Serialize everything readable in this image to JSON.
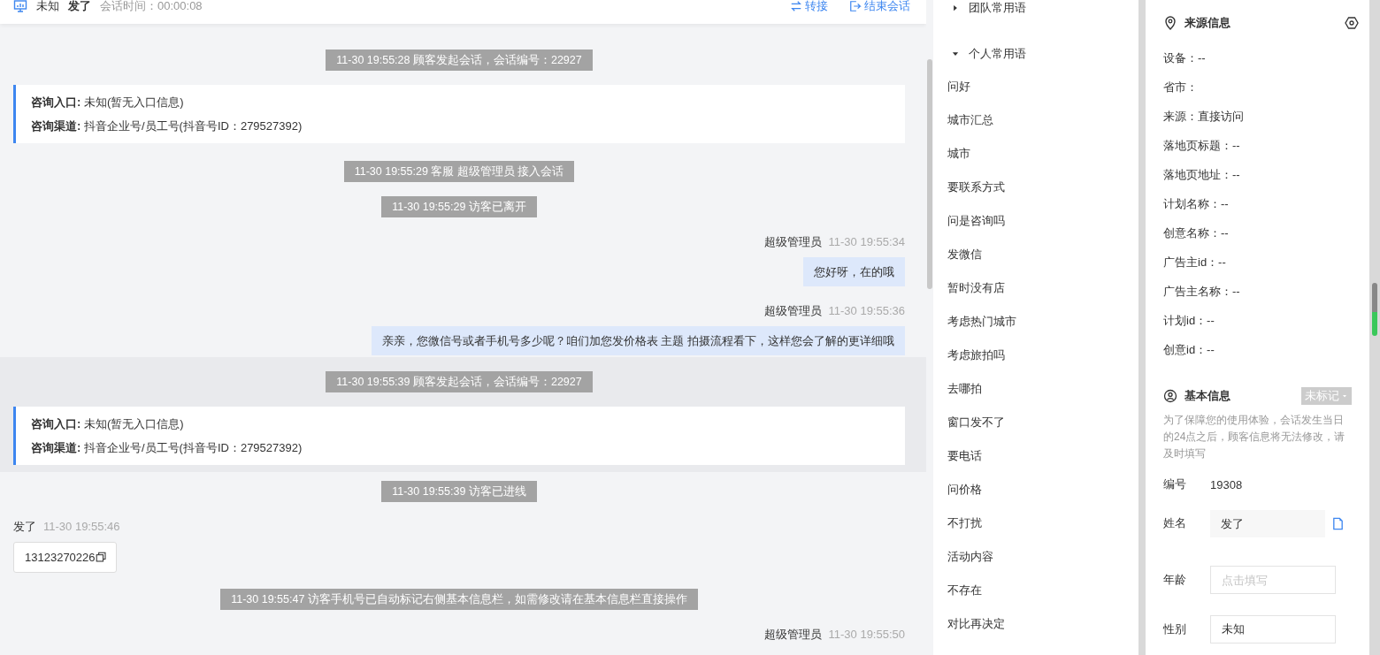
{
  "header": {
    "status": "未知",
    "name": "发了",
    "session_time": "会话时间：00:00:08",
    "actions": [
      {
        "kind": "transfer",
        "label": "转接"
      },
      {
        "kind": "end",
        "label": "结束会话"
      }
    ]
  },
  "chat": {
    "sessions": [
      {
        "highlighted": false,
        "messages": [
          {
            "kind": "system",
            "text": "11-30 19:55:28 顾客发起会话，会话编号：22927"
          },
          {
            "kind": "entry-card",
            "lines": [
              {
                "label": "咨询入口:",
                "value": "未知(暂无入口信息)"
              },
              {
                "label": "咨询渠道:",
                "value": "抖音企业号/员工号(抖音号ID：279527392)"
              }
            ]
          },
          {
            "kind": "system",
            "text": "11-30 19:55:29 客服 超级管理员 接入会话"
          },
          {
            "kind": "system",
            "text": "11-30 19:55:29 访客已离开"
          },
          {
            "kind": "agent",
            "sender": "超级管理员",
            "time": "11-30 19:55:34",
            "text": "您好呀，在的哦"
          },
          {
            "kind": "agent",
            "sender": "超级管理员",
            "time": "11-30 19:55:36",
            "text": "亲亲，您微信号或者手机号多少呢？咱们加您发价格表 主题 拍摄流程看下，这样您会了解的更详细哦"
          }
        ]
      },
      {
        "highlighted": true,
        "messages": [
          {
            "kind": "system",
            "text": "11-30 19:55:39 顾客发起会话，会话编号：22927"
          },
          {
            "kind": "entry-card",
            "lines": [
              {
                "label": "咨询入口:",
                "value": "未知(暂无入口信息)"
              },
              {
                "label": "咨询渠道:",
                "value": "抖音企业号/员工号(抖音号ID：279527392)"
              }
            ]
          }
        ]
      },
      {
        "highlighted": false,
        "messages": [
          {
            "kind": "system",
            "text": "11-30 19:55:39 访客已进线"
          },
          {
            "kind": "visitor",
            "sender": "发了",
            "time": "11-30 19:55:46",
            "text": "13123270226"
          },
          {
            "kind": "system",
            "text": "11-30 19:55:47 访客手机号已自动标记右侧基本信息栏，如需修改请在基本信息栏直接操作"
          },
          {
            "kind": "agent-header",
            "sender": "超级管理员",
            "time": "11-30 19:55:50"
          }
        ]
      }
    ]
  },
  "phrases": {
    "groups": [
      {
        "title": "团队常用语",
        "expanded": false
      },
      {
        "title": "个人常用语",
        "expanded": true,
        "items": [
          "问好",
          "城市汇总",
          "城市",
          "要联系方式",
          "问是咨询吗",
          "发微信",
          "暂时没有店",
          "考虑热门城市",
          "考虑旅拍吗",
          "去哪拍",
          "窗口发不了",
          "要电话",
          "问价格",
          "不打扰",
          "活动内容",
          "不存在",
          "对比再决定"
        ]
      }
    ]
  },
  "source_info": {
    "title": "来源信息",
    "fields": [
      "设备：--",
      "省市：",
      "来源：直接访问",
      "落地页标题：--",
      "落地页地址：--",
      "计划名称：--",
      "创意名称：--",
      "广告主id：--",
      "广告主名称：--",
      "计划id：--",
      "创意id：--"
    ]
  },
  "basic_info": {
    "title": "基本信息",
    "tag": "未标记",
    "notice": "为了保障您的使用体验，会话发生当日的24点之后，顾客信息将无法修改，请及时填写",
    "fields": [
      {
        "kind": "text",
        "label": "编号",
        "value": "19308"
      },
      {
        "kind": "filled",
        "label": "姓名",
        "value": "发了"
      },
      {
        "kind": "input",
        "label": "年龄",
        "placeholder": "点击填写"
      },
      {
        "kind": "input",
        "label": "性别",
        "value": "未知"
      }
    ]
  }
}
